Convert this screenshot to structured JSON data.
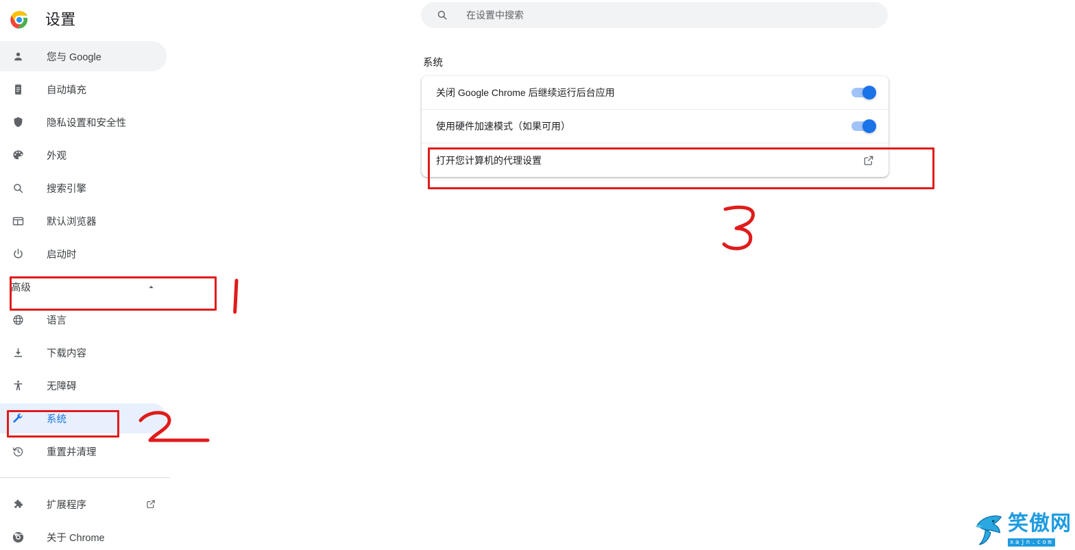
{
  "app": {
    "title": "设置",
    "logo_icon": "chrome-logo-icon"
  },
  "search": {
    "placeholder": "在设置中搜索",
    "value": "",
    "icon": "search-icon"
  },
  "sidebar": {
    "items": [
      {
        "label": "您与 Google",
        "icon": "person-icon",
        "state": "hover"
      },
      {
        "label": "自动填充",
        "icon": "clipboard-icon",
        "state": "normal"
      },
      {
        "label": "隐私设置和安全性",
        "icon": "shield-icon",
        "state": "normal"
      },
      {
        "label": "外观",
        "icon": "palette-icon",
        "state": "normal"
      },
      {
        "label": "搜索引擎",
        "icon": "search-icon",
        "state": "normal"
      },
      {
        "label": "默认浏览器",
        "icon": "browser-window-icon",
        "state": "normal"
      },
      {
        "label": "启动时",
        "icon": "power-icon",
        "state": "normal"
      }
    ],
    "advanced": {
      "label": "高级",
      "chevron_icon": "chevron-up-icon",
      "expanded": true
    },
    "advanced_items": [
      {
        "label": "语言",
        "icon": "globe-icon",
        "state": "normal"
      },
      {
        "label": "下载内容",
        "icon": "download-icon",
        "state": "normal"
      },
      {
        "label": "无障碍",
        "icon": "accessibility-icon",
        "state": "normal"
      },
      {
        "label": "系统",
        "icon": "wrench-icon",
        "state": "selected"
      },
      {
        "label": "重置并清理",
        "icon": "history-restore-icon",
        "state": "normal"
      }
    ],
    "footer_items": [
      {
        "label": "扩展程序",
        "icon": "puzzle-icon",
        "trailing_icon": "external-link-icon"
      },
      {
        "label": "关于 Chrome",
        "icon": "chrome-logo-icon",
        "trailing_icon": ""
      }
    ]
  },
  "main": {
    "section_title": "系统",
    "rows": [
      {
        "label": "关闭 Google Chrome 后继续运行后台应用",
        "control": "toggle",
        "value": "on"
      },
      {
        "label": "使用硬件加速模式（如果可用）",
        "control": "toggle",
        "value": "on"
      },
      {
        "label": "打开您计算机的代理设置",
        "control": "external-link",
        "value": ""
      }
    ]
  },
  "annotations": {
    "color": "#e01b1b",
    "marks": [
      {
        "kind": "box",
        "target": "高级"
      },
      {
        "kind": "box",
        "target": "系统"
      },
      {
        "kind": "box",
        "target": "打开您计算机的代理设置"
      },
      {
        "kind": "handwriting",
        "text": "1"
      },
      {
        "kind": "handwriting",
        "text": "2"
      },
      {
        "kind": "handwriting",
        "text": "3"
      }
    ]
  },
  "watermark": {
    "title": "笑傲网",
    "subtitle": "xajn.com",
    "icon": "shark-logo-icon",
    "color": "#1e9be0"
  }
}
